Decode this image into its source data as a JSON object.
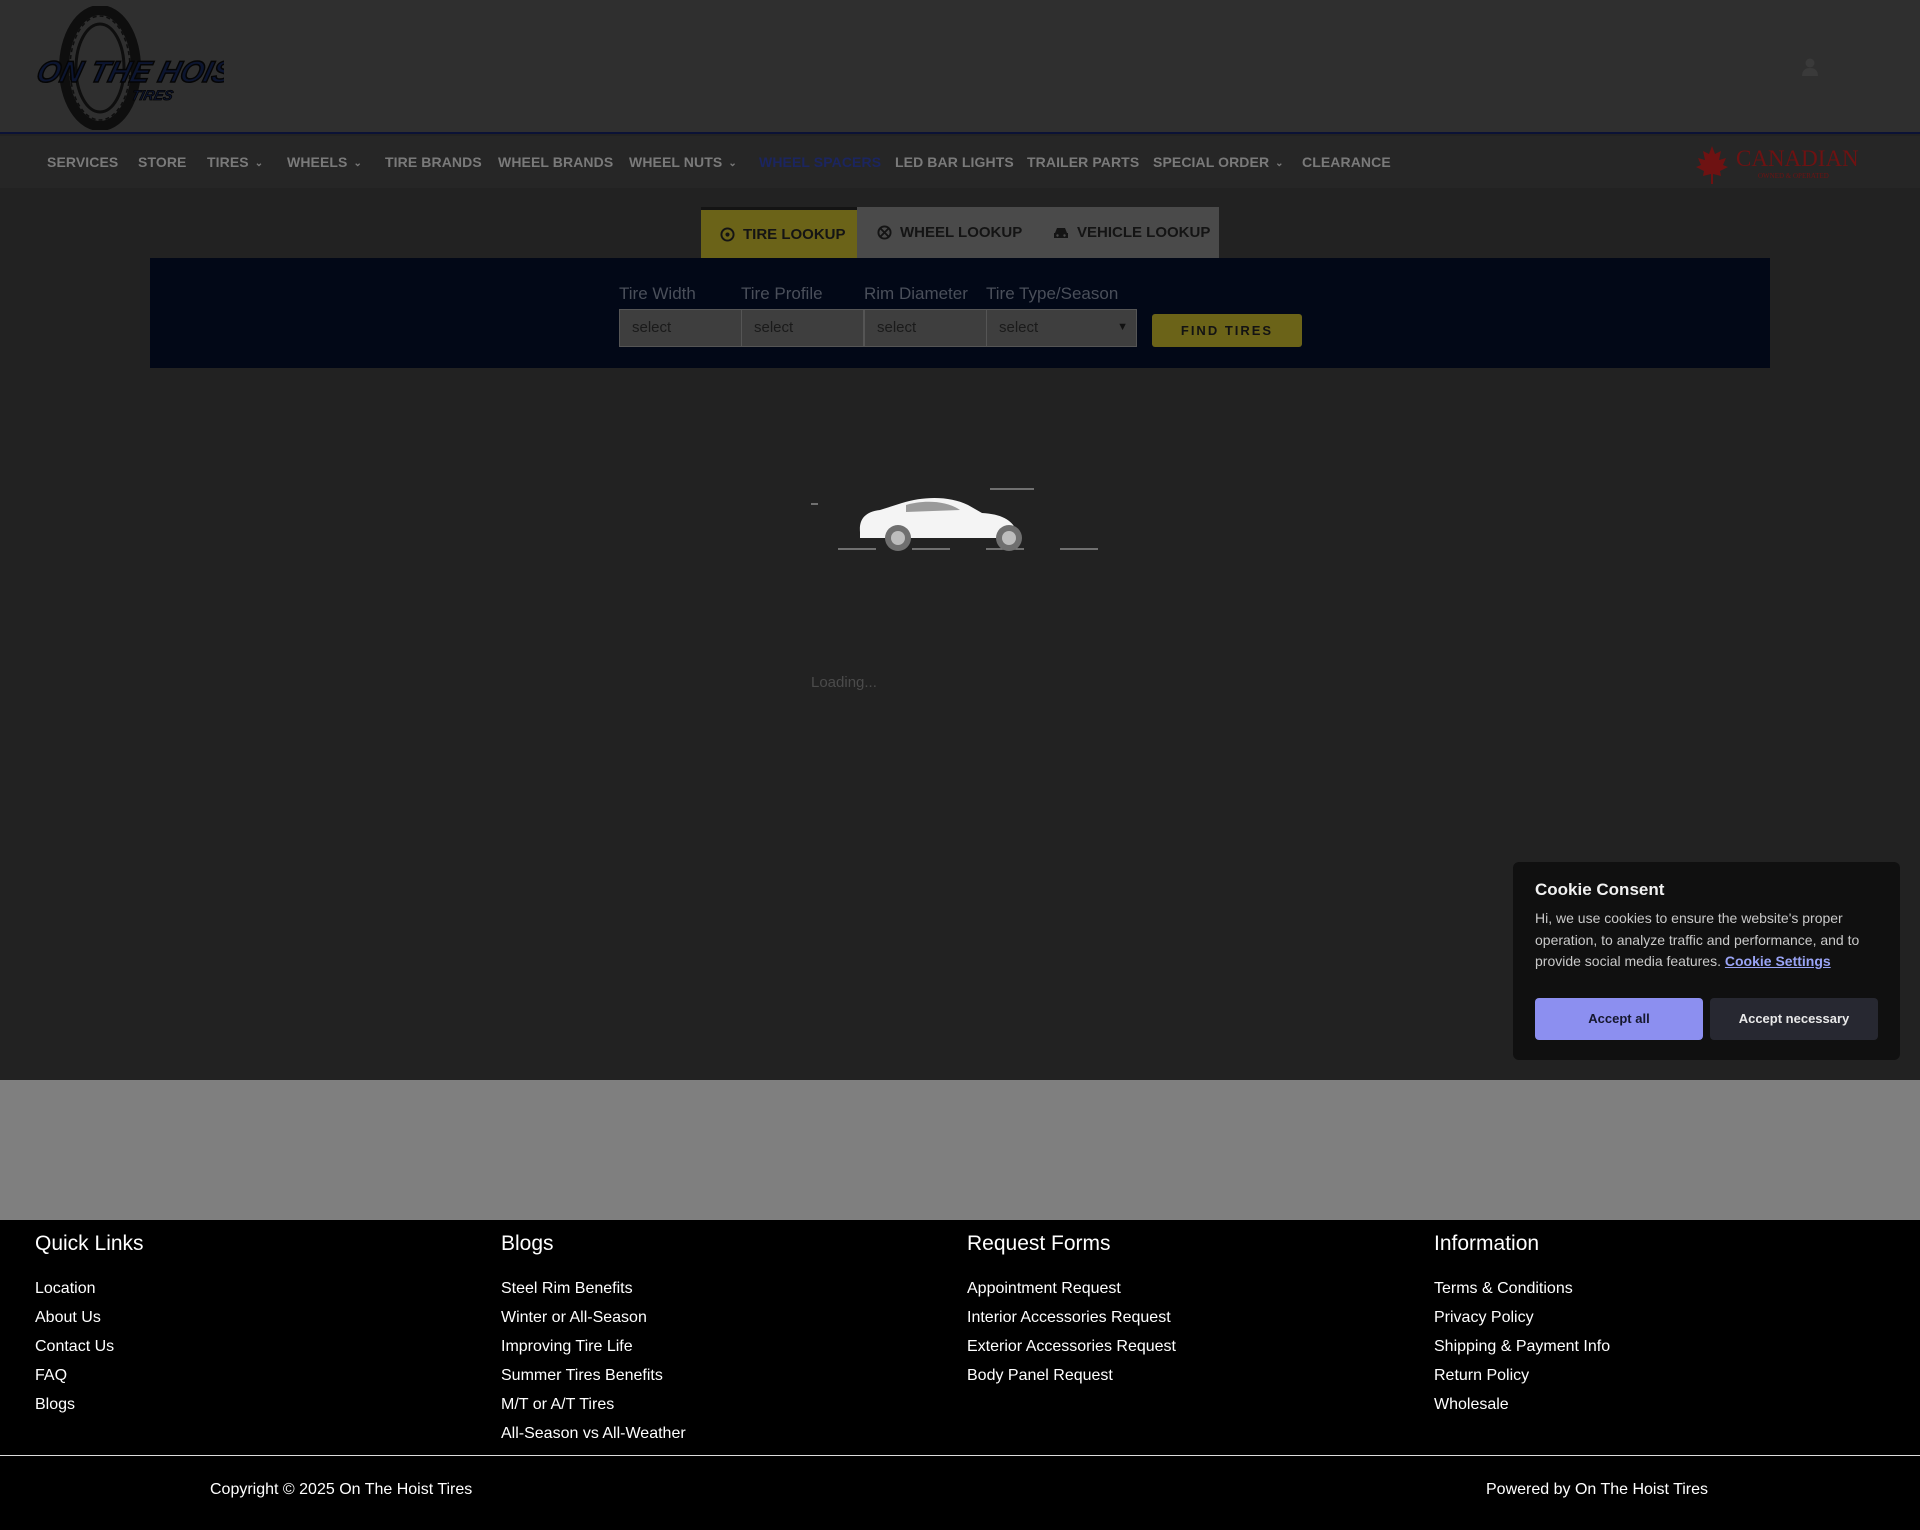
{
  "header": {
    "logo_text": "ON THE HOIST",
    "logo_subtext": "TIRES",
    "account_icon": "user-icon"
  },
  "nav": {
    "items": [
      {
        "label": "SERVICES",
        "dropdown": false
      },
      {
        "label": "STORE",
        "dropdown": false
      },
      {
        "label": "TIRES",
        "dropdown": true
      },
      {
        "label": "WHEELS",
        "dropdown": true
      },
      {
        "label": "TIRE BRANDS",
        "dropdown": false
      },
      {
        "label": "WHEEL BRANDS",
        "dropdown": false
      },
      {
        "label": "WHEEL NUTS",
        "dropdown": true
      },
      {
        "label": "WHEEL SPACERS",
        "dropdown": false,
        "active": true
      },
      {
        "label": "LED BAR LIGHTS",
        "dropdown": false
      },
      {
        "label": "TRAILER PARTS",
        "dropdown": false
      },
      {
        "label": "SPECIAL ORDER",
        "dropdown": true
      },
      {
        "label": "CLEARANCE",
        "dropdown": false
      }
    ],
    "partner_logo": {
      "text": "CANADIAN",
      "subtext": "OWNED & OPERATED"
    }
  },
  "lookup": {
    "tabs": [
      {
        "label": "TIRE LOOKUP",
        "icon": "tire-icon",
        "active": true
      },
      {
        "label": "WHEEL LOOKUP",
        "icon": "wheel-icon",
        "active": false
      },
      {
        "label": "VEHICLE LOOKUP",
        "icon": "car-icon",
        "active": false
      }
    ],
    "fields": [
      {
        "label": "Tire Width",
        "value": "select"
      },
      {
        "label": "Tire Profile",
        "value": "select"
      },
      {
        "label": "Rim Diameter",
        "value": "select"
      },
      {
        "label": "Tire Type/Season",
        "value": "select"
      }
    ],
    "button_label": "FIND TIRES"
  },
  "loader": {
    "text": "Loading..."
  },
  "footer": {
    "columns": [
      {
        "heading": "Quick Links",
        "links": [
          "Location",
          "About Us",
          "Contact Us",
          "FAQ",
          "Blogs"
        ]
      },
      {
        "heading": "Blogs",
        "links": [
          "Steel Rim Benefits",
          "Winter or All-Season",
          "Improving Tire Life",
          "Summer Tires Benefits",
          "M/T or A/T Tires",
          "All-Season vs All-Weather"
        ]
      },
      {
        "heading": "Request Forms",
        "links": [
          "Appointment Request",
          "Interior Accessories Request",
          "Exterior Accessories Request",
          "Body Panel Request"
        ]
      },
      {
        "heading": "Information",
        "links": [
          "Terms & Conditions",
          "Privacy Policy",
          "Shipping & Payment Info",
          "Return Policy",
          "Wholesale"
        ]
      }
    ],
    "copyright": "Copyright © 2025 On The Hoist Tires",
    "powered_by": "Powered by On The Hoist Tires"
  },
  "cookie": {
    "title": "Cookie Consent",
    "message": "Hi, we use cookies to ensure the website's proper operation, to analyze traffic and performance, and to provide social media features.",
    "settings_link": "Cookie Settings",
    "accept_all": "Accept all",
    "accept_necessary": "Accept necessary"
  },
  "colors": {
    "accent": "#6b6318",
    "panel": "#020817",
    "cookie_primary": "#8c8ff0"
  }
}
